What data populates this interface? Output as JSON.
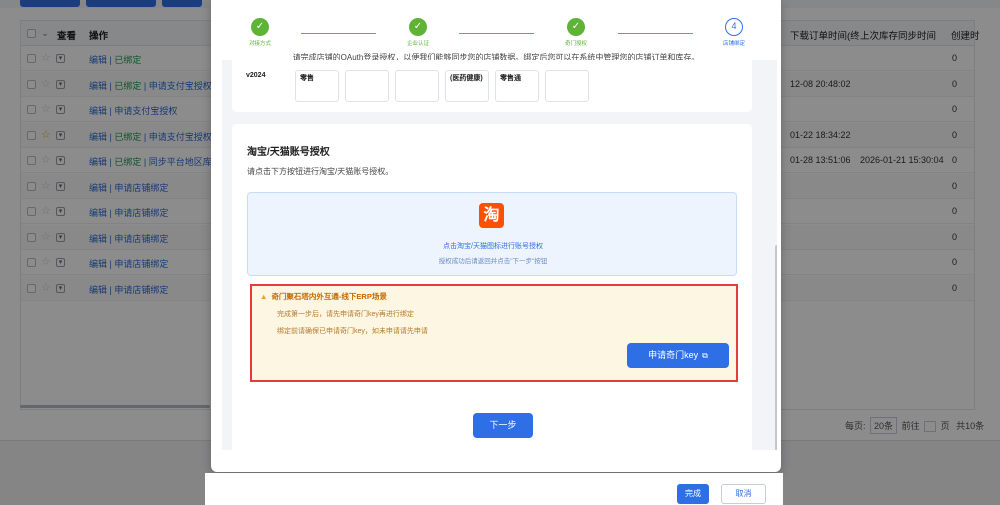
{
  "background": {
    "table_headers": {
      "view": "查看",
      "ops": "操作",
      "download_time": "下载订单时间(终",
      "stock_sync": "上次库存同步时间",
      "created": "创建时"
    },
    "rows": [
      {
        "ops_prefix": "编辑 | ",
        "ops_green": "已绑定",
        "ops_suffix": "",
        "starred": false,
        "time1": "",
        "time2": "",
        "count": "0"
      },
      {
        "ops_prefix": "编辑 | ",
        "ops_green": "已绑定",
        "ops_suffix": " | 申请支付宝授权",
        "starred": false,
        "time1": "12-08 20:48:02",
        "time2": "",
        "count": "0"
      },
      {
        "ops_prefix": "编辑 | 申请支付宝授权",
        "ops_green": "",
        "ops_suffix": "",
        "starred": false,
        "time1": "",
        "time2": "",
        "count": "0"
      },
      {
        "ops_prefix": "编辑 | ",
        "ops_green": "已绑定",
        "ops_suffix": " | 申请支付宝授权",
        "starred": true,
        "time1": "01-22 18:34:22",
        "time2": "",
        "count": "0"
      },
      {
        "ops_prefix": "编辑 | ",
        "ops_green": "已绑定",
        "ops_suffix": " | 同步平台地区库",
        "starred": false,
        "time1": "01-28 13:51:06",
        "time2": "2026-01-21 15:30:04",
        "count": "0"
      },
      {
        "ops_prefix": "编辑 | 申请店铺绑定",
        "ops_green": "",
        "ops_suffix": "",
        "starred": false,
        "time1": "",
        "time2": "",
        "count": "0"
      },
      {
        "ops_prefix": "编辑 | 申请店铺绑定",
        "ops_green": "",
        "ops_suffix": "",
        "starred": false,
        "time1": "",
        "time2": "",
        "count": "0"
      },
      {
        "ops_prefix": "编辑 | 申请店铺绑定",
        "ops_green": "",
        "ops_suffix": "",
        "starred": false,
        "time1": "",
        "time2": "",
        "count": "0"
      },
      {
        "ops_prefix": "编辑 | 申请店铺绑定",
        "ops_green": "",
        "ops_suffix": "",
        "starred": false,
        "time1": "",
        "time2": "",
        "count": "0"
      },
      {
        "ops_prefix": "编辑 | 申请店铺绑定",
        "ops_green": "",
        "ops_suffix": "",
        "starred": false,
        "time1": "",
        "time2": "",
        "count": "0"
      }
    ],
    "pager": {
      "per_page_label": "每页:",
      "per_page": "20条",
      "goto": "前往",
      "page_unit": "页",
      "total": "共10条"
    }
  },
  "dialog": {
    "steps": [
      {
        "label": "对接方式",
        "icon": "✓"
      },
      {
        "label": "企业认证",
        "icon": "✓"
      },
      {
        "label": "奇门授权",
        "icon": "✓"
      },
      {
        "label": "店铺绑定",
        "icon": "4"
      }
    ],
    "step_description": "请完成店铺的OAuth登录授权，以便我们能够同步您的店铺数据。绑定后您可以在系统中管理您的店铺订单和库存。",
    "card1": {
      "v_label": "v2024",
      "retail1": "零售",
      "medical": "(医药健康)",
      "retail2": "零售通"
    },
    "taobao": {
      "title": "淘宝/天猫账号授权",
      "desc": "请点击下方按钮进行淘宝/天猫账号授权。",
      "logo_char": "淘",
      "link": "点击淘宝/天猫图标进行账号授权",
      "hint": "授权成功后请返回并点击\"下一步\"按钮"
    },
    "erp": {
      "title": "奇门聚石塔内外互通-线下ERP场景",
      "line1": "完成第一步后，请先申请奇门key再进行绑定",
      "line2": "绑定前请确保已申请奇门key，如未申请请先申请",
      "button": "申请奇门key",
      "button_icon": "⧉"
    },
    "next_button": "下一步"
  },
  "footer": {
    "done": "完成",
    "cancel": "取消"
  },
  "colors": {
    "primary": "#2f6fe6",
    "success": "#5fb336",
    "warning_border": "#e23d3d",
    "taobao": "#ff5000"
  }
}
